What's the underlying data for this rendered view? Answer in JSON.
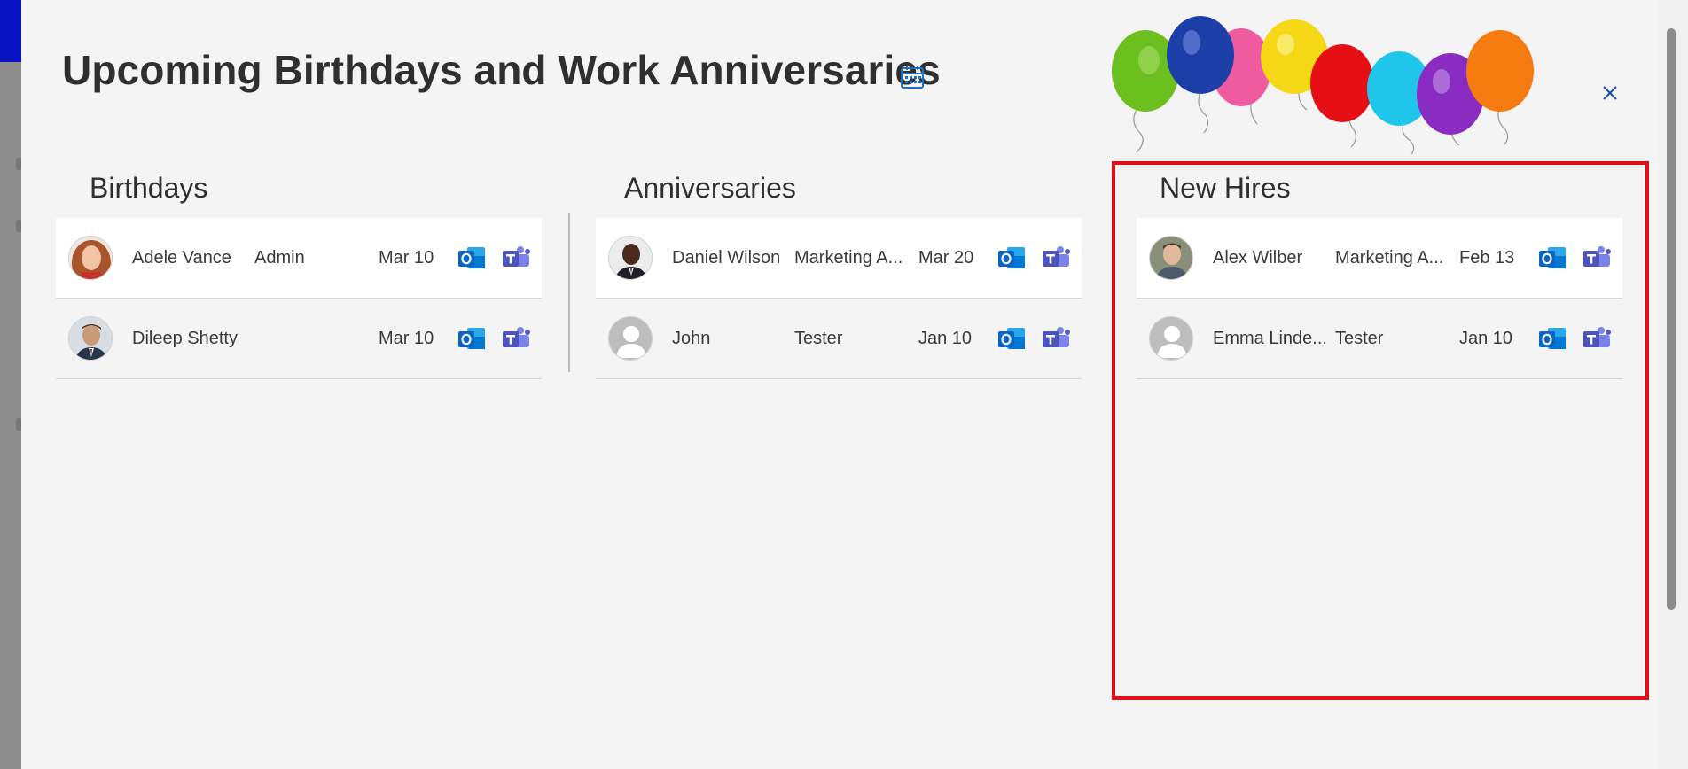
{
  "dialog": {
    "title": "Upcoming Birthdays and Work Anniversaries",
    "calendar_icon": "calendar-icon",
    "close_icon": "close-icon"
  },
  "columns": {
    "birthdays": {
      "title": "Birthdays",
      "rows": [
        {
          "name": "Adele Vance",
          "role": "Admin",
          "date": "Mar 10",
          "avatar": "photo"
        },
        {
          "name": "Dileep Shetty",
          "role": "",
          "date": "Mar 10",
          "avatar": "photo"
        }
      ]
    },
    "anniversaries": {
      "title": "Anniversaries",
      "rows": [
        {
          "name": "Daniel Wilson",
          "role": "Marketing A...",
          "date": "Mar 20",
          "avatar": "photo"
        },
        {
          "name": "John",
          "role": "Tester",
          "date": "Jan 10",
          "avatar": "default-person"
        }
      ]
    },
    "new_hires": {
      "title": "New Hires",
      "rows": [
        {
          "name": "Alex Wilber",
          "role": "Marketing A...",
          "date": "Feb 13",
          "avatar": "photo"
        },
        {
          "name": "Emma Linde...",
          "role": "Tester",
          "date": "Jan 10",
          "avatar": "default-person"
        }
      ]
    }
  },
  "icons": {
    "outlook": "outlook-icon",
    "teams": "teams-icon"
  },
  "colors": {
    "highlight": "#e0101a",
    "outlook_blue": "#0a64c8",
    "teams_purple": "#5b5fc7"
  }
}
